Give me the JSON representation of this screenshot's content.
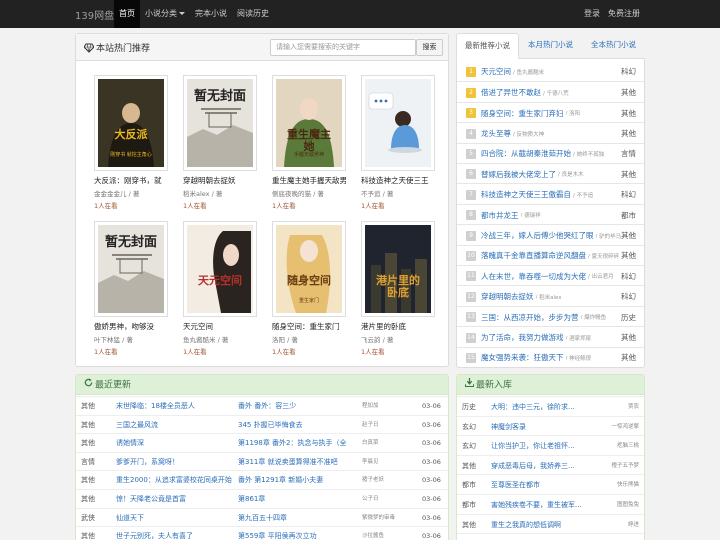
{
  "nav": {
    "brand": "139网盘",
    "items": [
      {
        "label": "首页",
        "active": true
      },
      {
        "label": "小说分类",
        "dropdown": true
      },
      {
        "label": "完本小说"
      },
      {
        "label": "阅读历史"
      }
    ],
    "login": "登录",
    "register": "免费注册"
  },
  "hot": {
    "title": "本站热门推荐",
    "search_placeholder": "请输入您需要搜索的关键字",
    "search_button": "搜索",
    "books": [
      {
        "title": "大反派：刚穿书，就",
        "author": "金金金金儿 / 著",
        "status": "1人在看"
      },
      {
        "title": "穿越明朝去捉妖",
        "author": "稻米alex / 著",
        "status": "1人在看"
      },
      {
        "title": "重生魔主她手握天敌男",
        "author": "侧底夜晚的猫 / 著",
        "status": "1人在看"
      },
      {
        "title": "科技造神之天使三王",
        "author": "不予追 / 著",
        "status": "1人在看"
      },
      {
        "title": "傲娇男神，吻够没",
        "author": "叶下林猛 / 著",
        "status": "1人在看"
      },
      {
        "title": "天元空间",
        "author": "鱼丸酱酷米 / 著",
        "status": "1人在看"
      },
      {
        "title": "随身空间：重生家门",
        "author": "洛阳 / 著",
        "status": "1人在看"
      },
      {
        "title": "港片里的卧底",
        "author": "飞云韵 / 著",
        "status": "1人在看"
      }
    ],
    "covers": [
      {
        "text": "大反派",
        "sub": "刚穿书 就挖主角心"
      },
      {
        "text": "暂无封面",
        "sub": ""
      },
      {
        "text": "重生魔主她",
        "sub": "手握天敌男神"
      },
      {
        "text": "",
        "sub": ""
      },
      {
        "text": "暂无封面",
        "sub": ""
      },
      {
        "text": "天元空间",
        "sub": ""
      },
      {
        "text": "随身空间",
        "sub": "重生家门"
      },
      {
        "text": "港片里的卧底",
        "sub": ""
      }
    ]
  },
  "rank": {
    "tabs": [
      "最新推荐小说",
      "本月热门小说",
      "全本热门小说"
    ],
    "items": [
      {
        "num": "1",
        "name": "天元空间",
        "author": "/ 鱼丸酱酷米",
        "cat": "科幻"
      },
      {
        "num": "2",
        "name": "借进了异世不敢赵",
        "author": "/ 千德八荒",
        "cat": "其他"
      },
      {
        "num": "3",
        "name": "随身空间：重生家门弃妇",
        "author": "/ 洛阳",
        "cat": "其他"
      },
      {
        "num": "4",
        "name": "龙头至尊",
        "author": "/ 反物质大神",
        "cat": "其他"
      },
      {
        "num": "5",
        "name": "四合院：从截胡秦淮茹开始",
        "author": "/ 她终不孤独",
        "cat": "言情"
      },
      {
        "num": "6",
        "name": "替嫁后我被大佬宠上了",
        "author": "/ 良是木木",
        "cat": "其他"
      },
      {
        "num": "7",
        "name": "科技造神之天使三王傲霸自",
        "author": "/ 不予追",
        "cat": "科幻"
      },
      {
        "num": "8",
        "name": "都市井龙王",
        "author": "/ 德瑞祥",
        "cat": "都市"
      },
      {
        "num": "9",
        "name": "冷战三年，嫁人后傅少他哭红了眼",
        "author": "/ 驴的毕马",
        "cat": "其他"
      },
      {
        "num": "10",
        "name": "落魄真千金靠直播算命逆风翻盘",
        "author": "/ 夏天很碎碎",
        "cat": "其他"
      },
      {
        "num": "11",
        "name": "人在末世，靠吞噬一切成为大佬",
        "author": "/ 出云君月",
        "cat": "科幻"
      },
      {
        "num": "12",
        "name": "穿越明朝去捉妖",
        "author": "/ 稻米alex",
        "cat": "科幻"
      },
      {
        "num": "13",
        "name": "三国：从西凉开始，步步为营",
        "author": "/ 爆炸鳗鱼",
        "cat": "历史"
      },
      {
        "num": "14",
        "name": "为了活命，我努力做游戏",
        "author": "/ 酒家郑尾",
        "cat": "其他"
      },
      {
        "num": "15",
        "name": "魔女强势来袭：狂傲天下",
        "author": "/ 神经鲸很",
        "cat": "其他"
      }
    ]
  },
  "updates": {
    "title": "最近更新",
    "rows": [
      {
        "cat": "其他",
        "book": "末世降临：18楼全员恶人",
        "chapter": "番外 番外：容三少",
        "author": "程加加",
        "date": "03-06"
      },
      {
        "cat": "其他",
        "book": "三国之最风流",
        "chapter": "345 扑握已毕悔食去",
        "author": "赵子日",
        "date": "03-06"
      },
      {
        "cat": "其他",
        "book": "诱她情深",
        "chapter": "第1198章 番外2：执念与执手（全",
        "author": "白真菜",
        "date": "03-06"
      },
      {
        "cat": "言情",
        "book": "爹爹开门，系窝呀！",
        "chapter": "第311章 就说卖蛋算得准不准吧",
        "author": "李晨见",
        "date": "03-06"
      },
      {
        "cat": "其他",
        "book": "重生2000：从追求富婆校花同桌开始",
        "chapter": "番外 第1291章 新婚小夫妻",
        "author": "猪子老妖",
        "date": "03-06"
      },
      {
        "cat": "其他",
        "book": "惊！天降老公竟是首富",
        "chapter": "第861章",
        "author": "公子日",
        "date": "03-06"
      },
      {
        "cat": "武侠",
        "book": "仙道天下",
        "chapter": "第九百五十四章",
        "author": "紫微梦的审毒",
        "date": "03-06"
      },
      {
        "cat": "其他",
        "book": "世子元别死，夫人有喜了",
        "chapter": "第559章 平阳侯再次立功",
        "author": "沙拉酱鱼",
        "date": "03-06"
      }
    ]
  },
  "newlist": {
    "title": "最新入库",
    "rows": [
      {
        "cat": "历史",
        "book": "大明：违中三元，徐阶求...",
        "author": "贾农"
      },
      {
        "cat": "玄幻",
        "book": "神魔剑客录",
        "author": "一惊鸿逆擎"
      },
      {
        "cat": "玄幻",
        "book": "让你当护卫，你让老祖怀...",
        "author": "疙脑三桃"
      },
      {
        "cat": "其他",
        "book": "穿成恶毒后母，我娇养三...",
        "author": "橙子五予梦"
      },
      {
        "cat": "都市",
        "book": "至尊医圣在都市",
        "author": "快乐熊猫"
      },
      {
        "cat": "都市",
        "book": "害她残疾卷不要，重生被军...",
        "author": "图图兔兔"
      },
      {
        "cat": "其他",
        "book": "重生之我真的想低调啊",
        "author": "婷进"
      },
      {
        "cat": "其他",
        "book": "在AZ地球建立人皇联",
        "author": "喵宝川水霞张鹤"
      }
    ]
  },
  "colors": {
    "rank_top": "#f0c33a",
    "rank_rest": "#cfcfcf",
    "link": "#2a6eb8",
    "green_head": "#dff0d8"
  }
}
